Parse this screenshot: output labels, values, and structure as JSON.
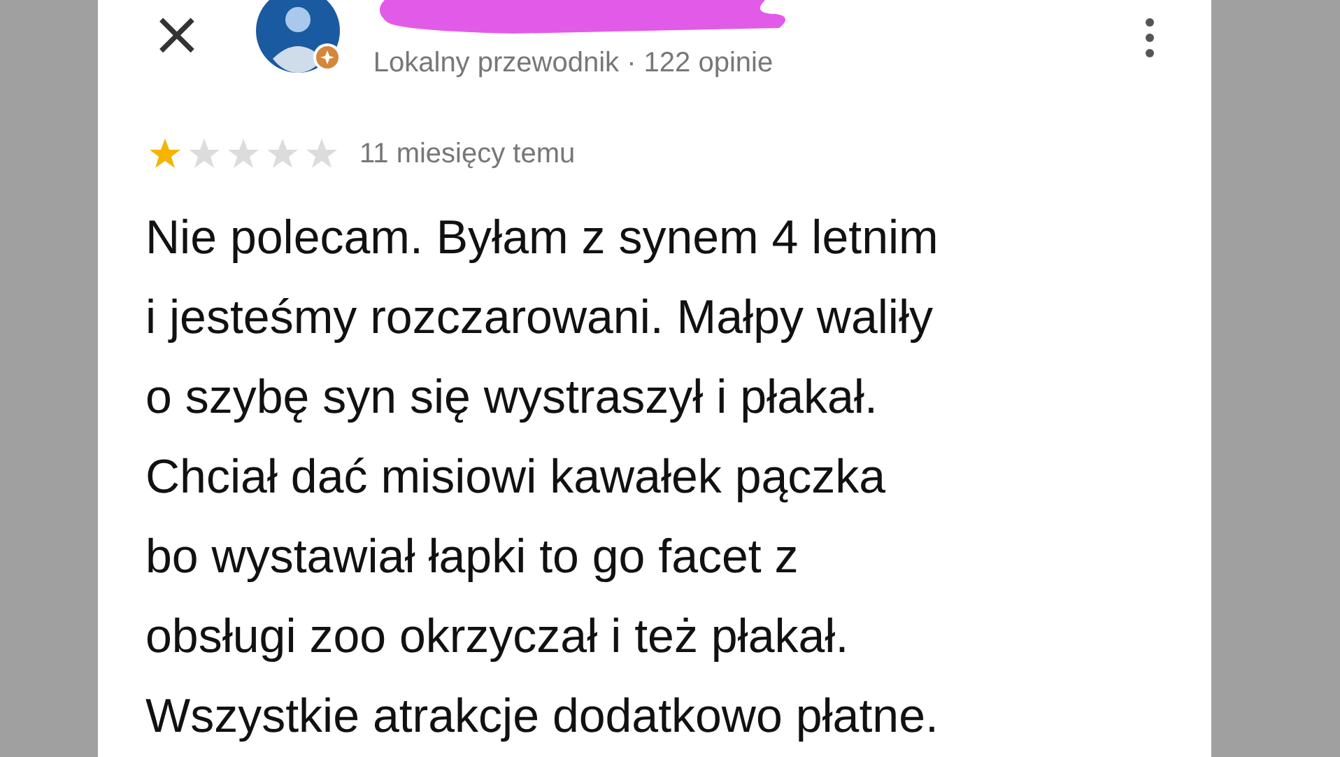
{
  "review": {
    "close": "×",
    "reviewer_meta": "Lokalny przewodnik · 122 opinie",
    "stars": 1,
    "time": "11 miesięcy temu",
    "text": "Nie polecam. Byłam z synem 4 letnim\ni jesteśmy rozczarowani. Małpy waliły\no szybę syn się wystraszył i płakał.\nChciał dać misiowi kawałek pączka\nbo wystawiał łapki to go facet z\nobsługi zoo okrzyczał i też płakał.\nWszystkie atrakcje dodatkowo płatne."
  }
}
